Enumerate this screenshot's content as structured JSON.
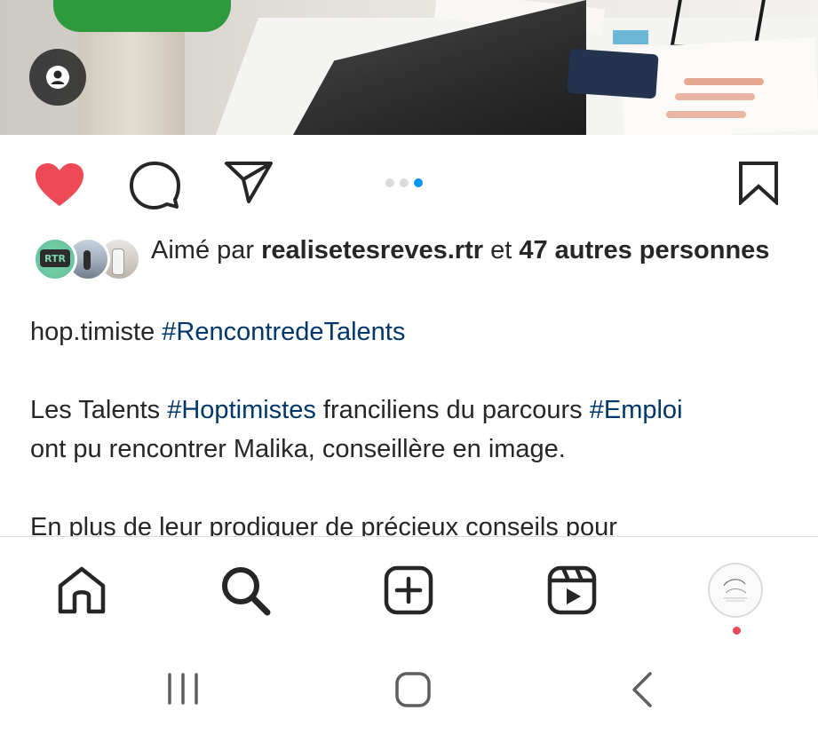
{
  "post": {
    "photo": {
      "user_tag_icon": "person-tag-icon"
    },
    "actions": {
      "like_icon": "heart-filled-icon",
      "like_color": "#ed4956",
      "comment_icon": "comment-icon",
      "share_icon": "paper-plane-icon",
      "save_icon": "bookmark-icon",
      "carousel": {
        "total": 3,
        "active_index": 2,
        "active_color": "#0095f6"
      }
    },
    "likes": {
      "prefix": "Aimé par ",
      "user": "realisetesreves.rtr",
      "middle": " et ",
      "others": "47 autres personnes"
    },
    "caption": {
      "username": "hop.timiste",
      "hashtag1": "#RencontredeTalents",
      "p1_a": "Les Talents ",
      "p1_tag1": "#Hoptimistes",
      "p1_b": " franciliens du parcours ",
      "p1_tag2": "#Emploi",
      "p1_c": "ont pu rencontrer Malika, conseillère en image.",
      "p2": "En plus de leur prodiguer de précieux conseils pour"
    },
    "tag_color": "#00376b"
  },
  "nav": {
    "items": [
      {
        "name": "home",
        "icon": "home-icon"
      },
      {
        "name": "search",
        "icon": "search-icon"
      },
      {
        "name": "create",
        "icon": "plus-square-icon"
      },
      {
        "name": "reels",
        "icon": "reels-icon"
      },
      {
        "name": "profile",
        "icon": "profile-avatar"
      }
    ],
    "profile_badge_color": "#ed4956"
  },
  "system_nav": {
    "recents_icon": "recents-icon",
    "home_icon": "system-home-icon",
    "back_icon": "back-chevron-icon"
  }
}
